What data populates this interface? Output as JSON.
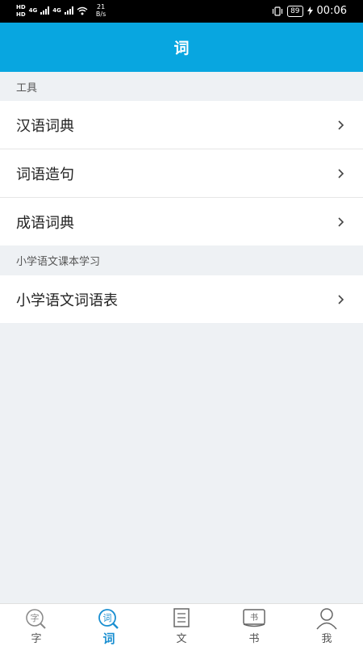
{
  "status_bar": {
    "left": {
      "hd1": "HD",
      "hd2": "HD",
      "net1": "4G",
      "net2": "4G",
      "speed_value": "21",
      "speed_unit": "B/s"
    },
    "right": {
      "battery": "89",
      "time": "00:06"
    }
  },
  "header": {
    "title": "词"
  },
  "sections": [
    {
      "title": "工具",
      "items": [
        "汉语词典",
        "词语造句",
        "成语词典"
      ]
    },
    {
      "title": "小学语文课本学习",
      "items": [
        "小学语文词语表"
      ]
    }
  ],
  "bottom_nav": [
    {
      "label": "字",
      "icon": "zi-search-icon",
      "active": false
    },
    {
      "label": "词",
      "icon": "ci-search-icon",
      "active": true
    },
    {
      "label": "文",
      "icon": "document-icon",
      "active": false
    },
    {
      "label": "书",
      "icon": "book-icon",
      "active": false
    },
    {
      "label": "我",
      "icon": "person-icon",
      "active": false
    }
  ],
  "colors": {
    "accent": "#08a6e0",
    "active_tab": "#1a8fd1"
  }
}
